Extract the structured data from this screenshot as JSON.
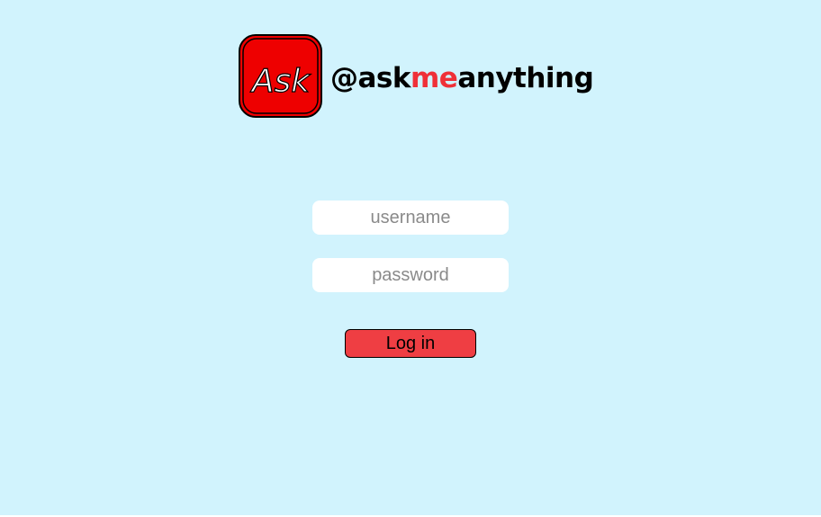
{
  "brand": {
    "logo_text": "Ask",
    "handle_prefix": "@ask",
    "handle_accent": "me",
    "handle_suffix": "anything",
    "accent_color": "#ef3038",
    "logo_color": "#ee0000"
  },
  "login_form": {
    "username_placeholder": "username",
    "username_value": "",
    "password_placeholder": "password",
    "password_value": "",
    "submit_label": "Log in",
    "submit_color": "#ef3e43"
  },
  "page": {
    "background_color": "#d1f3fd"
  }
}
